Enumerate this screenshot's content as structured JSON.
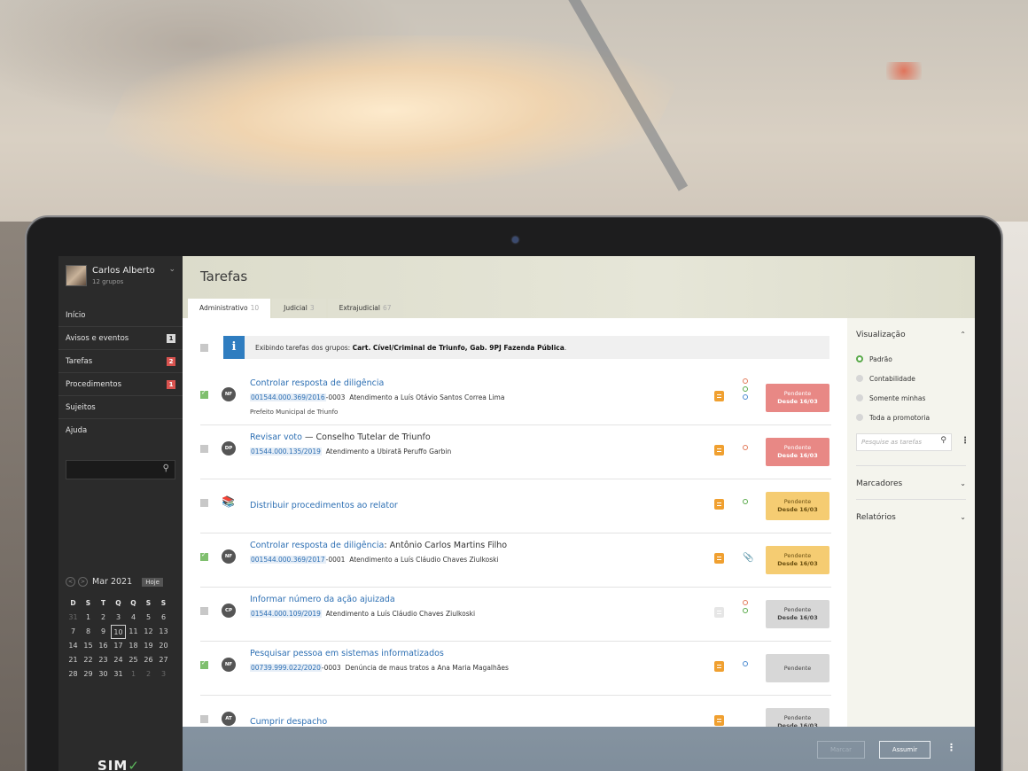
{
  "user": {
    "name": "Carlos Alberto",
    "groups": "12 grupos"
  },
  "nav": [
    {
      "label": "Início",
      "badge": ""
    },
    {
      "label": "Avisos e eventos",
      "badge": "1"
    },
    {
      "label": "Tarefas",
      "badge": "2"
    },
    {
      "label": "Procedimentos",
      "badge": "1"
    },
    {
      "label": "Sujeitos",
      "badge": ""
    },
    {
      "label": "Ajuda",
      "badge": ""
    }
  ],
  "calendar": {
    "month": "Mar 2021",
    "today_label": "Hoje",
    "dow": [
      "D",
      "S",
      "T",
      "Q",
      "Q",
      "S",
      "S"
    ],
    "days": [
      "31",
      "1",
      "2",
      "3",
      "4",
      "5",
      "6",
      "7",
      "8",
      "9",
      "10",
      "11",
      "12",
      "13",
      "14",
      "15",
      "16",
      "17",
      "18",
      "19",
      "20",
      "21",
      "22",
      "23",
      "24",
      "25",
      "26",
      "27",
      "28",
      "29",
      "30",
      "31",
      "1",
      "2",
      "3"
    ]
  },
  "logo": {
    "text": "SIM"
  },
  "page": {
    "title": "Tarefas"
  },
  "tabs": [
    {
      "label": "Administrativo",
      "count": "10"
    },
    {
      "label": "Judicial",
      "count": "3"
    },
    {
      "label": "Extrajudicial",
      "count": "67"
    }
  ],
  "info": {
    "prefix": "Exibindo tarefas dos grupos:",
    "groups": "Cart. Cível/Criminal de Triunfo, Gab. 9PJ Fazenda Pública",
    "suffix": "."
  },
  "tasks": [
    {
      "badge": "NF",
      "checked": true,
      "title": "Controlar resposta de diligência",
      "title_extra": "",
      "proc": "001544.000.369/2016",
      "proc_suffix": "-0003",
      "sub": "Atendimento a Luís Otávio Santos Correa Lima",
      "sub2": "Prefeito Municipal de Triunfo",
      "status": "Pendente",
      "since": "Desde 16/03"
    },
    {
      "badge": "DP",
      "checked": false,
      "title": "Revisar voto",
      "title_extra": " — Conselho Tutelar de Triunfo",
      "proc": "01544.000.135/2019",
      "proc_suffix": "",
      "sub": "Atendimento a Ubiratã Peruffo Garbin",
      "sub2": "",
      "status": "Pendente",
      "since": "Desde 16/03"
    },
    {
      "badge": "",
      "checked": false,
      "title": "Distribuir procedimentos ao relator",
      "title_extra": "",
      "proc": "",
      "proc_suffix": "",
      "sub": "",
      "sub2": "",
      "status": "Pendente",
      "since": "Desde 16/03"
    },
    {
      "badge": "NF",
      "checked": true,
      "title": "Controlar resposta de diligência",
      "title_extra": ": Antônio Carlos Martins Filho",
      "proc": "001544.000.369/2017",
      "proc_suffix": "-0001",
      "sub": "Atendimento a Luís Cláudio Chaves Ziulkoski",
      "sub2": "",
      "status": "Pendente",
      "since": "Desde 16/03"
    },
    {
      "badge": "CP",
      "checked": false,
      "title": "Informar número da ação ajuizada",
      "title_extra": "",
      "proc": "01544.000.109/2019",
      "proc_suffix": "",
      "sub": "Atendimento a Luís Cláudio Chaves Ziulkoski",
      "sub2": "",
      "status": "Pendente",
      "since": "Desde 16/03"
    },
    {
      "badge": "NF",
      "checked": true,
      "title": "Pesquisar pessoa em sistemas informatizados",
      "title_extra": "",
      "proc": "00739.999.022/2020",
      "proc_suffix": "-0003",
      "sub": "Denúncia de maus tratos a Ana Maria Magalhães",
      "sub2": "",
      "status": "Pendente",
      "since": ""
    },
    {
      "badge": "AT",
      "checked": false,
      "title": "Cumprir despacho",
      "title_extra": "",
      "proc": "",
      "proc_suffix": "",
      "sub": "",
      "sub2": "",
      "status": "Pendente",
      "since": "Desde 16/03"
    }
  ],
  "panel": {
    "visualizacao": "Visualização",
    "options": [
      "Padrão",
      "Contabilidade",
      "Somente minhas",
      "Toda a promotoria"
    ],
    "search_placeholder": "Pesquise as tarefas",
    "marcadores": "Marcadores",
    "relatorios": "Relatórios"
  },
  "actions": {
    "marcar": "Marcar",
    "assumir": "Assumir"
  },
  "colors": {
    "accent": "#2d6fb3",
    "status_red": "#e88885",
    "status_yellow": "#f5cc72",
    "status_gray": "#d7d7d7",
    "check_green": "#7fbf6e",
    "sidebar_bg": "#2b2b2b"
  }
}
